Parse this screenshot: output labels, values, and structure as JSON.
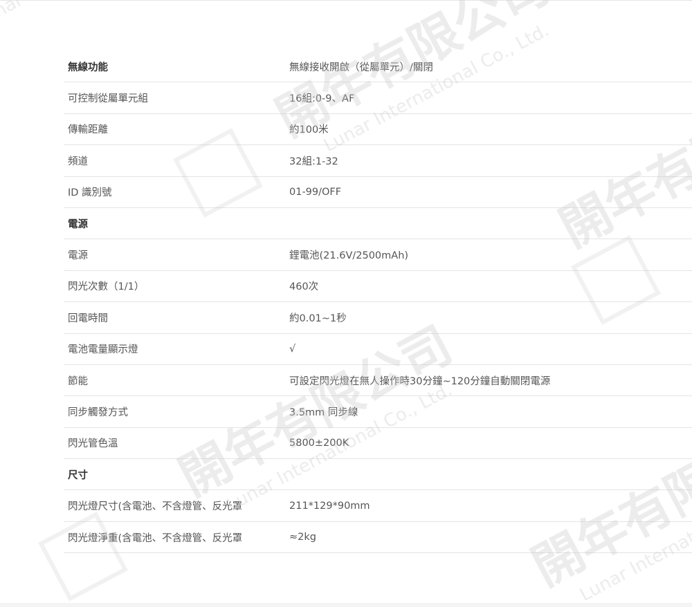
{
  "spec_rows": [
    {
      "type": "section",
      "label": "無線功能",
      "value": "無線接收開啟（從屬單元）/關閉"
    },
    {
      "type": "row",
      "label": "可控制從屬單元組",
      "value": "16組:0-9、AF"
    },
    {
      "type": "row",
      "label": "傳輸距離",
      "value": "約100米"
    },
    {
      "type": "row",
      "label": "頻道",
      "value": "32組:1-32"
    },
    {
      "type": "row",
      "label": "ID 識別號",
      "value": "01-99/OFF"
    },
    {
      "type": "section",
      "label": "電源",
      "value": ""
    },
    {
      "type": "row",
      "label": "電源",
      "value": "鋰電池(21.6V/2500mAh)"
    },
    {
      "type": "row",
      "label": "閃光次數（1/1）",
      "value": "460次"
    },
    {
      "type": "row",
      "label": "回電時間",
      "value": "約0.01~1秒"
    },
    {
      "type": "row",
      "label": "電池電量顯示燈",
      "value": "√"
    },
    {
      "type": "row",
      "label": "節能",
      "value": "可設定閃光燈在無人操作時30分鐘~120分鐘自動關閉電源"
    },
    {
      "type": "row",
      "label": "同步觸發方式",
      "value": "3.5mm 同步線"
    },
    {
      "type": "row",
      "label": "閃光管色溫",
      "value": "5800±200K"
    },
    {
      "type": "section",
      "label": "尺寸",
      "value": ""
    },
    {
      "type": "row",
      "label": "閃光燈尺寸(含電池、不含燈管、反光罩",
      "value": "211*129*90mm"
    },
    {
      "type": "row",
      "label": "閃光燈淨重(含電池、不含燈管、反光罩",
      "value": "≈2kg"
    }
  ],
  "watermark": {
    "company_cn": "開年有限公司",
    "company_en": "Lunar International Co., Ltd."
  },
  "colors": {
    "text": "#555555",
    "section_text": "#333333",
    "border": "#e4e4e4",
    "watermark": "#dddddd"
  }
}
